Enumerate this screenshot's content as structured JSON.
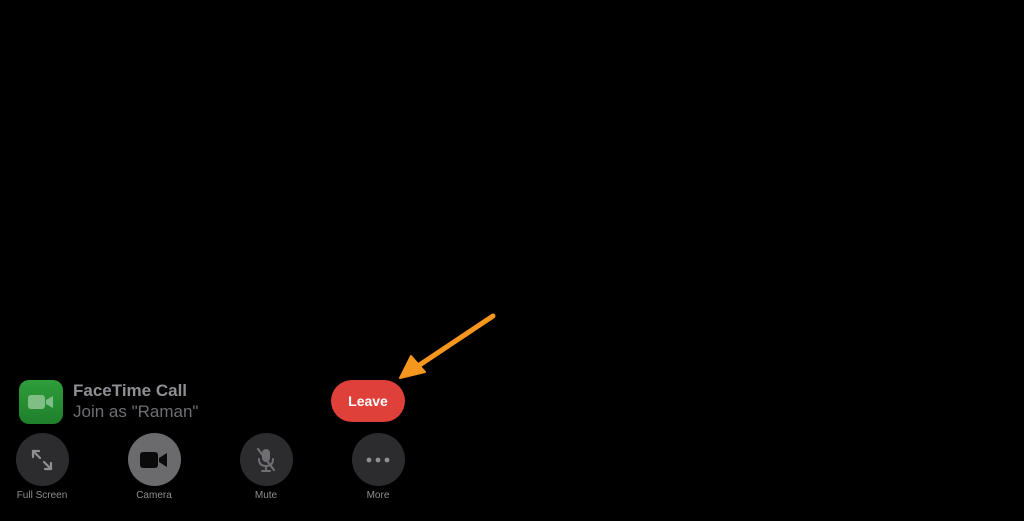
{
  "call": {
    "title": "FaceTime Call",
    "subtitle": "Join as \"Raman\"",
    "leave_label": "Leave"
  },
  "controls": [
    {
      "label": "Full Screen",
      "icon": "expand-arrows-icon"
    },
    {
      "label": "Camera",
      "icon": "video-camera-icon"
    },
    {
      "label": "Mute",
      "icon": "microphone-slash-icon"
    },
    {
      "label": "More",
      "icon": "ellipsis-icon"
    }
  ],
  "colors": {
    "background": "#000000",
    "leave_button": "#e0403a",
    "annotation_arrow": "#f5961e",
    "facetime_green": "#2e9e3a"
  }
}
